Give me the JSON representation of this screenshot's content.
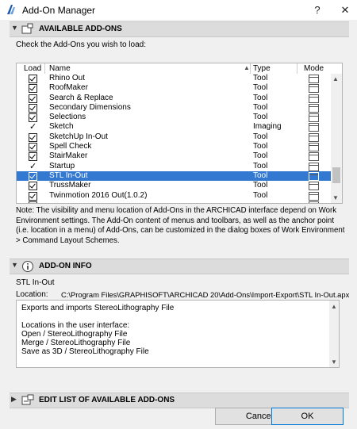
{
  "window": {
    "title": "Add-On Manager",
    "help_glyph": "?",
    "close_glyph": "✕"
  },
  "available": {
    "header": "AVAILABLE ADD-ONS",
    "instruction": "Check the Add-Ons you wish to load:",
    "columns": {
      "load": "Load",
      "name": "Name",
      "type": "Type",
      "mode": "Mode"
    },
    "rows": [
      {
        "name": "Rhino Out",
        "type": "Tool",
        "check": "box"
      },
      {
        "name": "RoofMaker",
        "type": "Tool",
        "check": "box"
      },
      {
        "name": "Search & Replace",
        "type": "Tool",
        "check": "box"
      },
      {
        "name": "Secondary Dimensions",
        "type": "Tool",
        "check": "box"
      },
      {
        "name": "Selections",
        "type": "Tool",
        "check": "box"
      },
      {
        "name": "Sketch",
        "type": "Imaging",
        "check": "tick"
      },
      {
        "name": "SketchUp In-Out",
        "type": "Tool",
        "check": "box"
      },
      {
        "name": "Spell Check",
        "type": "Tool",
        "check": "box"
      },
      {
        "name": "StairMaker",
        "type": "Tool",
        "check": "box"
      },
      {
        "name": "Startup",
        "type": "Tool",
        "check": "tick"
      },
      {
        "name": "STL In-Out",
        "type": "Tool",
        "check": "box",
        "selected": true
      },
      {
        "name": "TrussMaker",
        "type": "Tool",
        "check": "box"
      },
      {
        "name": "Twinmotion 2016 Out(1.0.2)",
        "type": "Tool",
        "check": "box"
      },
      {
        "name": "...",
        "type": "",
        "check": "box"
      }
    ],
    "note": "Note: The visibility and menu location of Add-Ons in the ARCHICAD interface depend on Work Environment settings. The Add-On content of menus and toolbars, as well as the anchor point (i.e. location in a menu) of Add-Ons, can be customized in the dialog boxes of Work Environment > Command Layout Schemes."
  },
  "info": {
    "header": "ADD-ON INFO",
    "selected_name": "STL In-Out",
    "location_label": "Location:",
    "location_value": "C:\\Program Files\\GRAPHISOFT\\ARCHICAD 20\\Add-Ons\\Import-Export\\STL In-Out.apx",
    "description_lines": [
      "Exports and imports StereoLithography File",
      "",
      "Locations in the user interface:",
      "Open / StereoLithography File",
      "Merge / StereoLithography File",
      "Save as 3D / StereoLithography File"
    ]
  },
  "edit": {
    "header": "EDIT LIST OF AVAILABLE ADD-ONS"
  },
  "buttons": {
    "cancel": "Cancel",
    "ok": "OK"
  },
  "colors": {
    "selection": "#3379d1",
    "section_bg": "#dcdcdc",
    "dialog_bg": "#f0f0f0"
  }
}
